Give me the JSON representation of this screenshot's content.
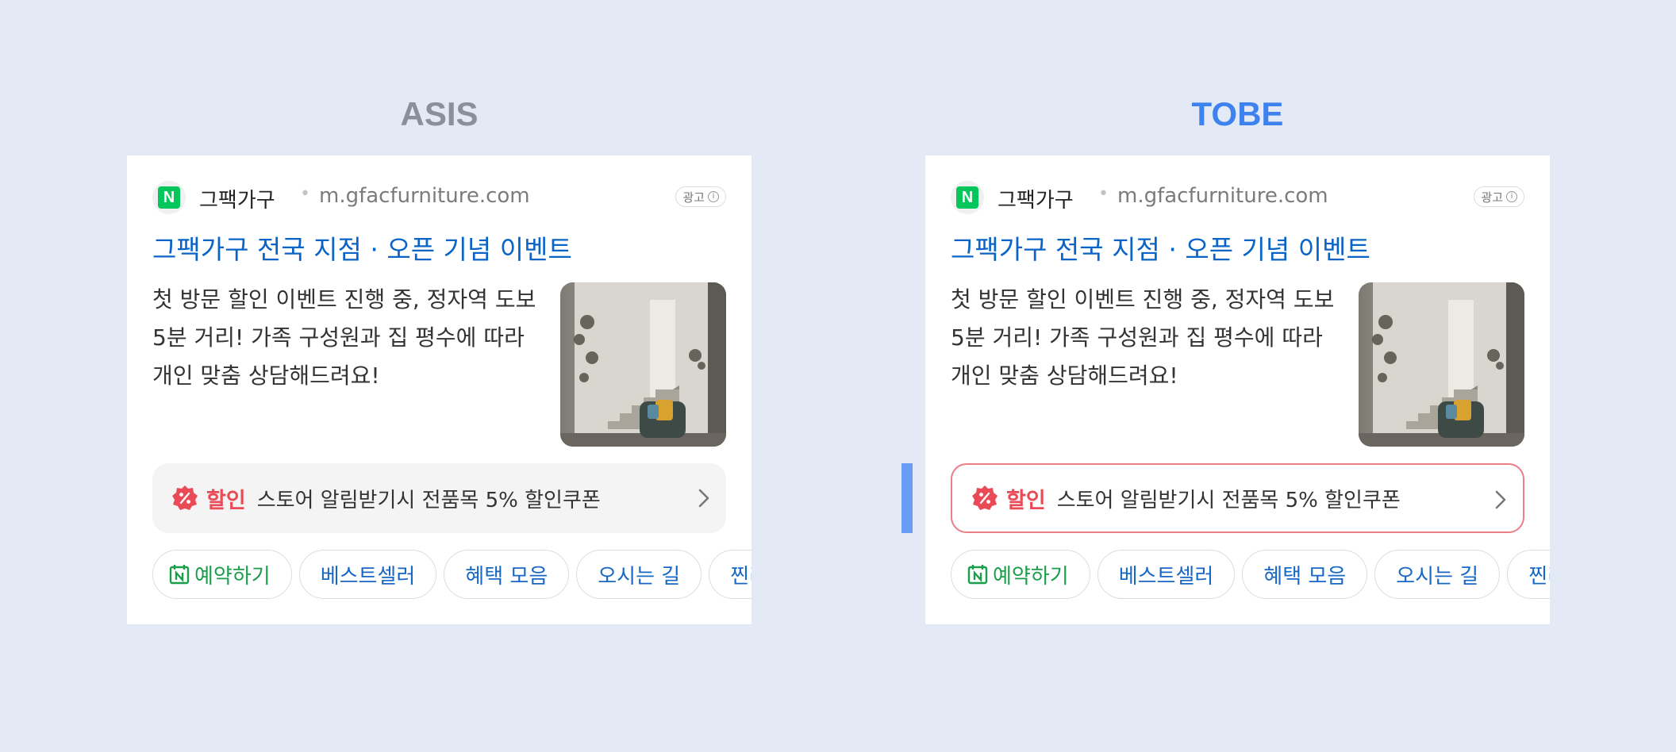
{
  "asis": {
    "title": "ASIS",
    "brand": "그팩가구",
    "separator": "•",
    "url": "m.gfacfurniture.com",
    "ad_label": "광고",
    "info_glyph": "i",
    "headline": "그팩가구 전국 지점 · 오픈 기념 이벤트",
    "description": "첫 방문 할인 이벤트 진행 중, 정자역 도보 5분 거리! 가족 구성원과 집 평수에 따라 개인 맞춤 상담해드려요!",
    "promo": {
      "tag": "할인",
      "text": "스토어 알림받기시 전품목 5% 할인쿠폰"
    },
    "chips": [
      "예약하기",
      "베스트셀러",
      "혜택 모음",
      "오시는 길",
      "찐리뷰"
    ]
  },
  "tobe": {
    "title": "TOBE",
    "brand": "그팩가구",
    "separator": "•",
    "url": "m.gfacfurniture.com",
    "ad_label": "광고",
    "info_glyph": "i",
    "headline": "그팩가구 전국 지점 · 오픈 기념 이벤트",
    "description": "첫 방문 할인 이벤트 진행 중, 정자역 도보 5분 거리! 가족 구성원과 집 평수에 따라 개인 맞춤 상담해드려요!",
    "promo": {
      "tag": "할인",
      "text": "스토어 알림받기시 전품목 5% 할인쿠폰"
    },
    "chips": [
      "예약하기",
      "베스트셀러",
      "혜택 모음",
      "오시는 길",
      "찐리뷰"
    ]
  },
  "logo_letter": "N",
  "colors": {
    "background": "#e4eaf5",
    "asis_title": "#8a9099",
    "tobe_title": "#3d82ee",
    "headline_link": "#0a64c8",
    "naver_green": "#03c75a",
    "promo_red": "#ea4a56",
    "tobe_promo_border": "#ed7d86",
    "chip_text": "#1767c4",
    "indicator": "#6b9cf5"
  },
  "icons": [
    "naver-logo-icon",
    "info-icon",
    "discount-badge-icon",
    "chevron-right-icon",
    "calendar-icon"
  ]
}
